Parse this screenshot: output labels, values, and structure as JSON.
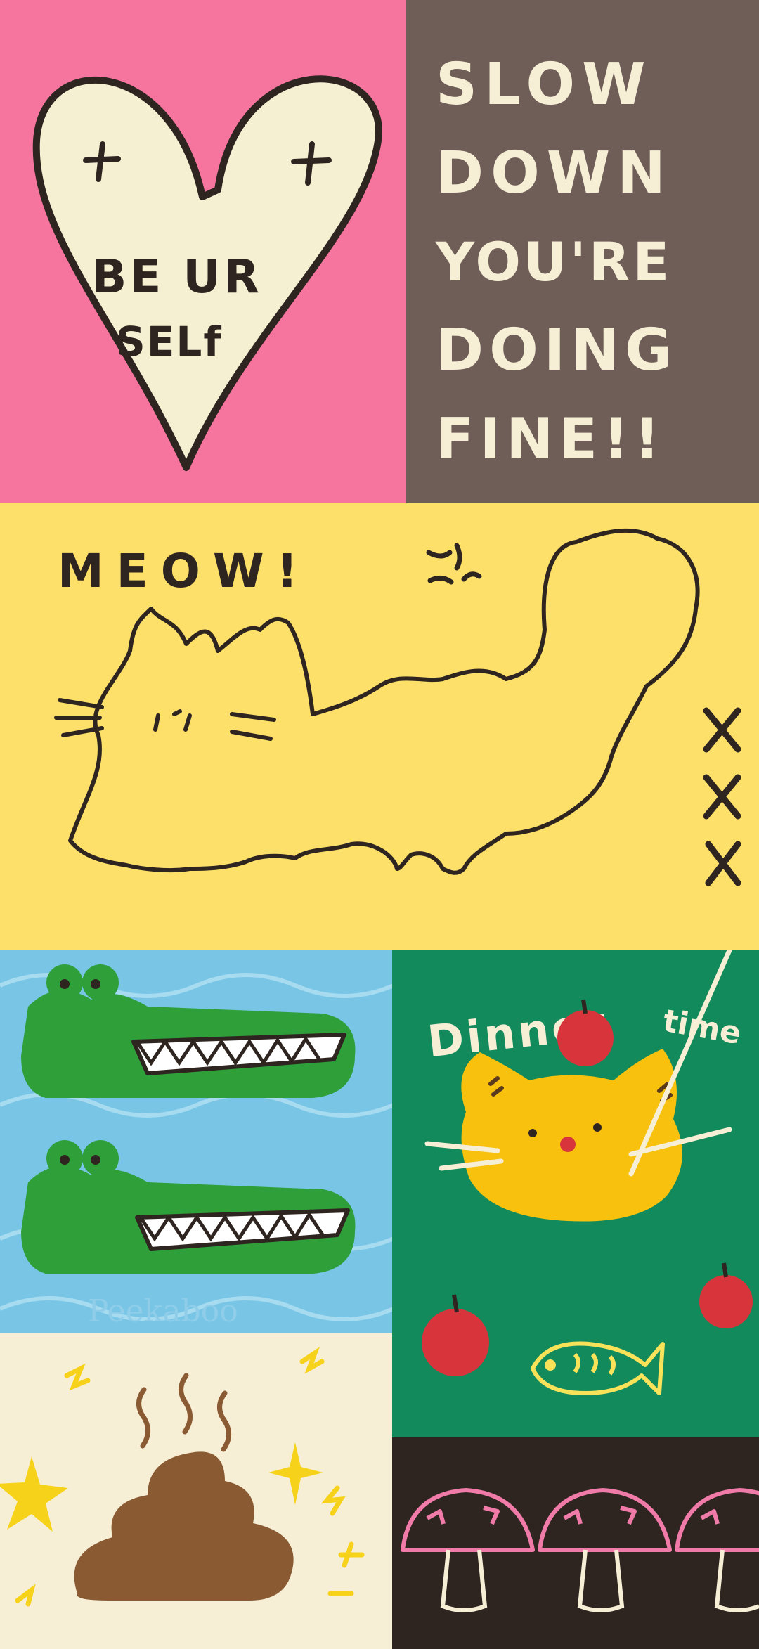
{
  "wallpaper": {
    "heart_text_line1": "BE UR",
    "heart_text_line2": "SELf",
    "slogan_lines": [
      "SLOW",
      "DOWN",
      "YOU'RE",
      "DOING",
      "FINE!!"
    ],
    "meow_text": "MEOW!",
    "xxx_marks": [
      "X",
      "X",
      "X"
    ],
    "dinner_text": "Dinner",
    "dinner_text_2": "time",
    "watermark": "Peekaboo"
  },
  "colors": {
    "pink": "#f5759f",
    "mocha": "#6f5e58",
    "yellow": "#fde06a",
    "sky": "#78c5e6",
    "green_panel": "#138a5c",
    "cream": "#f6efd6",
    "dark_brown": "#2f2520",
    "croc_green": "#2f9f3a",
    "cat_orange": "#f7c10d",
    "apple_red": "#d8343b",
    "poop_brown": "#8a5a33",
    "mushroom_pink": "#f07aa8"
  }
}
